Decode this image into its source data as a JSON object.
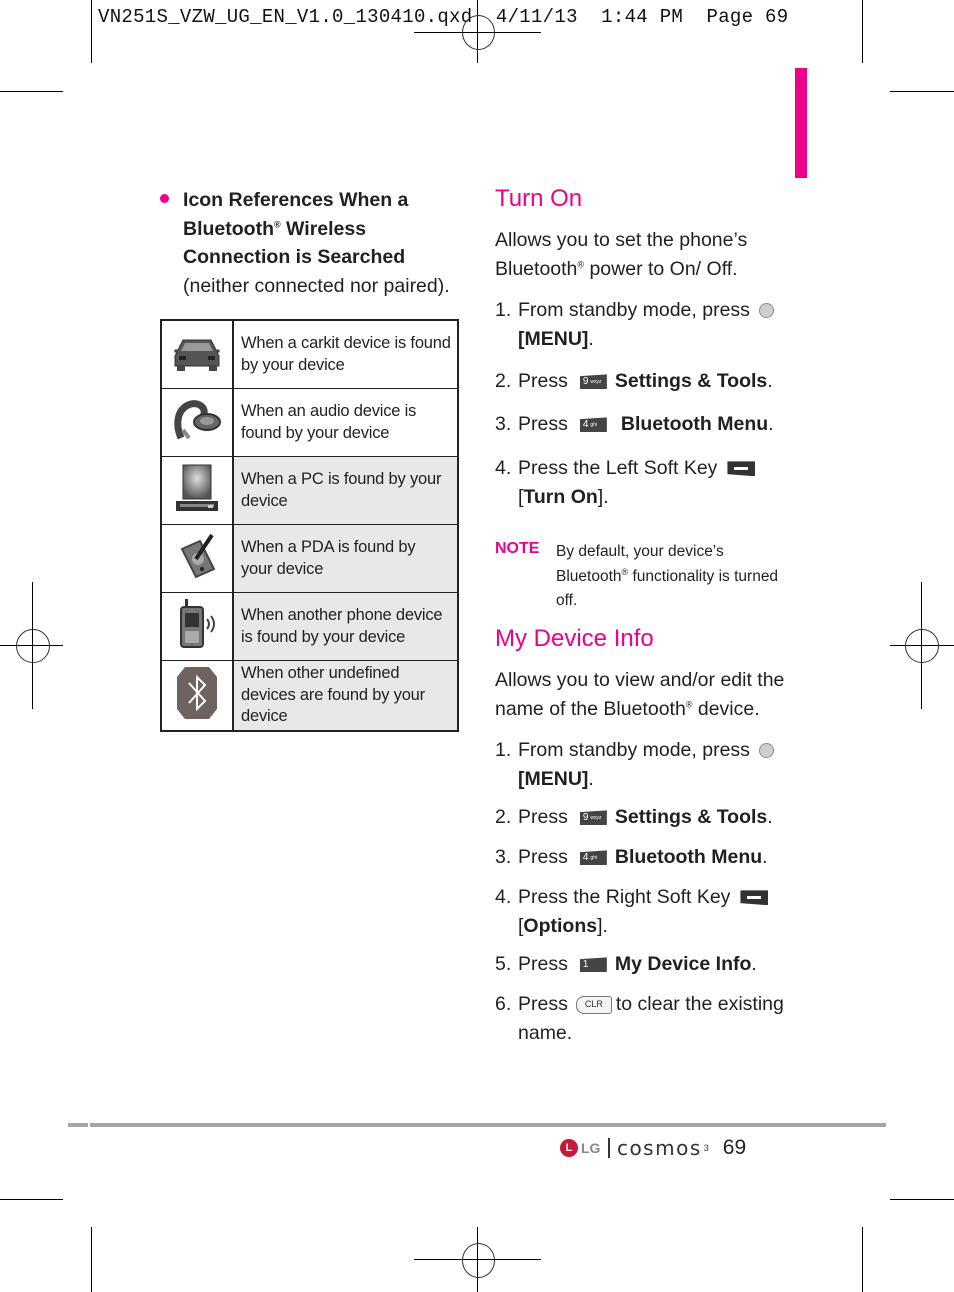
{
  "slug": {
    "text": "VN251S_VZW_UG_EN_V1.0_130410.qxd  4/11/13  1:44 PM  Page 69"
  },
  "left": {
    "bullet": {
      "line1": "Icon References When a",
      "line2_a": "Bluetooth",
      "line2_b": " Wireless",
      "line3": "Connection is Searched",
      "line4": "(neither connected nor paired).",
      "reg": "®"
    },
    "icon_table": [
      {
        "icon": "carkit-icon",
        "text": "When a carkit device is found by your device",
        "shaded": false
      },
      {
        "icon": "audio-headset-icon",
        "text": "When an audio device is found by your device",
        "shaded": false
      },
      {
        "icon": "pc-icon",
        "text": "When a PC is found by your device",
        "shaded": true
      },
      {
        "icon": "pda-icon",
        "text": "When a PDA is found by your device",
        "shaded": true
      },
      {
        "icon": "phone-icon",
        "text": "When another phone device is found by your device",
        "shaded": true
      },
      {
        "icon": "bluetooth-icon",
        "text": "When other undefined devices are found by your device",
        "shaded": true
      }
    ]
  },
  "right": {
    "turn_on": {
      "title": "Turn On",
      "desc_1": "Allows you to set the phone’s",
      "desc_2a": "Bluetooth",
      "desc_2b": " power to On/ Off.",
      "steps": {
        "s1_num": "1.",
        "s1_text": "From standby mode, press",
        "s1_key": "[MENU]",
        "s2_num": "2.",
        "s2_pre": "Press",
        "s2_key": "9",
        "s2_sub": "wxyz",
        "s2_bold": "Settings & Tools",
        "s3_num": "3.",
        "s3_pre": "Press",
        "s3_key": "4",
        "s3_sub": "ghi",
        "s3_bold": "Bluetooth Menu",
        "s4_num": "4.",
        "s4_text": "Press the Left Soft Key",
        "s4_bold": "Turn On"
      }
    },
    "note": {
      "label": "NOTE",
      "line1": "By default, your device’s",
      "line2a": "Bluetooth",
      "line2b": " functionality is turned",
      "line3": "off."
    },
    "my_device_info": {
      "title": "My Device Info",
      "desc_1": "Allows you to view and/or edit the",
      "desc_2a": "name of the Bluetooth",
      "desc_2b": " device.",
      "steps": {
        "s1_num": "1.",
        "s1_text": "From standby mode, press",
        "s1_key": "[MENU]",
        "s2_num": "2.",
        "s2_pre": "Press",
        "s2_key": "9",
        "s2_sub": "wxyz",
        "s2_bold": "Settings & Tools",
        "s3_num": "3.",
        "s3_pre": "Press",
        "s3_key": "4",
        "s3_sub": "ghi",
        "s3_bold": "Bluetooth Menu",
        "s4_num": "4.",
        "s4_text": "Press the Right Soft Key",
        "s4_bold": "Options",
        "s5_num": "5.",
        "s5_pre": "Press",
        "s5_key": "1",
        "s5_sub": "",
        "s5_bold": "My Device Info",
        "s6_num": "6.",
        "s6_pre": "Press",
        "s6_key": "CLR",
        "s6_post": "to clear the existing",
        "s6_cont": "name."
      }
    }
  },
  "footer": {
    "brand": "LG",
    "logo_glyph": "L",
    "model": "cosmos",
    "model_sup": "3",
    "page_number": "69"
  },
  "colors": {
    "accent": "#ec008c",
    "footer_bar": "#a7a7a7",
    "table_shade": "#e8e8e8"
  }
}
